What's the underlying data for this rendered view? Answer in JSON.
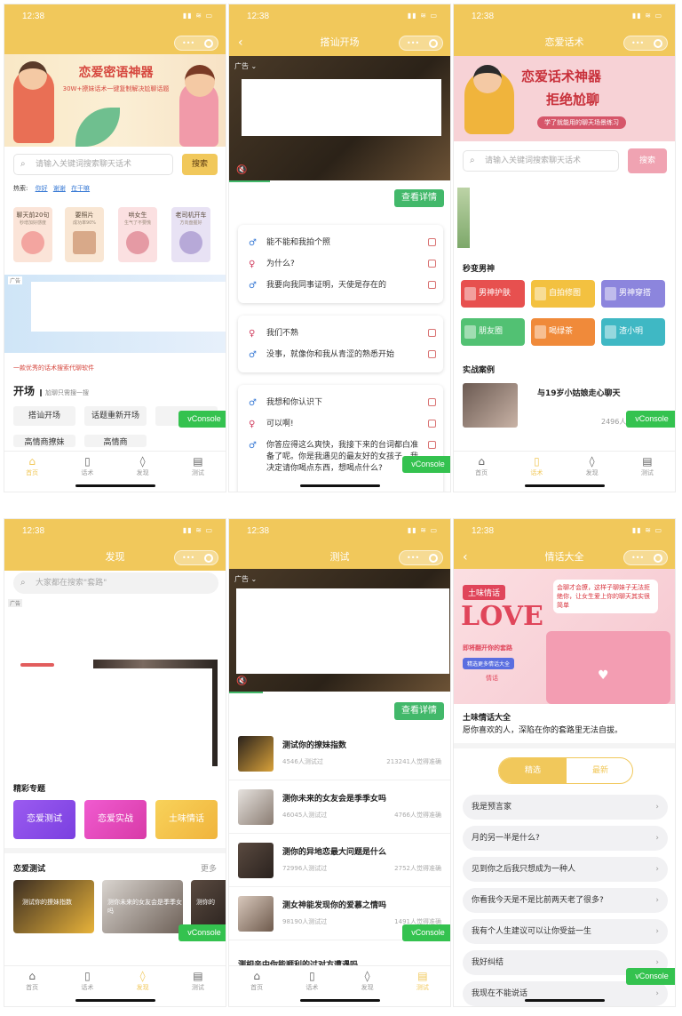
{
  "status": {
    "time": "12:38"
  },
  "capsule": {
    "dots": "•••"
  },
  "console_label": "vConsole",
  "tabs": [
    {
      "label": "首页",
      "icon": "home-icon"
    },
    {
      "label": "话术",
      "icon": "document-icon"
    },
    {
      "label": "发现",
      "icon": "flame-icon"
    },
    {
      "label": "测试",
      "icon": "file-icon"
    }
  ],
  "p1": {
    "banner": {
      "title": "恋爱密语神器",
      "subtitle": "30W+撩妹话术一键复制解决尬聊话题"
    },
    "search": {
      "placeholder": "请输入关键词搜索聊天话术",
      "button": "搜索"
    },
    "hot": {
      "label": "热索:",
      "items": [
        "你好",
        "谢谢",
        "在干嘛"
      ]
    },
    "features": [
      {
        "title": "聊天前20句",
        "sub": "秒增加好感度"
      },
      {
        "title": "要照片",
        "sub": "成功率90%"
      },
      {
        "title": "哄女生",
        "sub": "生气了不要慌"
      },
      {
        "title": "老司机开车",
        "sub": "方向盘握好"
      }
    ],
    "ad_label": "广告",
    "promo": "一款优秀的话术搜索代聊软件",
    "section": {
      "title": "开场",
      "sub": "尬聊只需搜一搜"
    },
    "tags": [
      "搭讪开场",
      "话题重新开场",
      "高情商撩妹",
      "高情商"
    ]
  },
  "p2": {
    "nav_title": "搭讪开场",
    "ad_label": "广告",
    "detail_button": "查看详情",
    "cards": [
      [
        {
          "sex": "m",
          "text": "能不能和我拍个照"
        },
        {
          "sex": "f",
          "text": "为什么?"
        },
        {
          "sex": "m",
          "text": "我要向我同事证明，天使是存在的"
        }
      ],
      [
        {
          "sex": "f",
          "text": "我们不熟"
        },
        {
          "sex": "m",
          "text": "没事，就像你和我从青涩的熟悉开始"
        }
      ],
      [
        {
          "sex": "m",
          "text": "我想和你认识下"
        },
        {
          "sex": "f",
          "text": "可以啊!"
        },
        {
          "sex": "m",
          "text": "你答应得这么爽快，我接下来的台词都白准备了呢。你是我遇见的最友好的女孩子，我决定请你喝点东西，想喝点什么?"
        }
      ]
    ]
  },
  "p3": {
    "nav_title": "恋爱话术",
    "banner": {
      "line1": "恋爱话术神器",
      "line2": "拒绝尬聊",
      "tagline": "学了就能用的聊天场景练习"
    },
    "search": {
      "placeholder": "请输入关键词搜索聊天话术",
      "button": "搜索"
    },
    "section1": "秒变男神",
    "categories": [
      "男神护肤",
      "自拍修图",
      "男神穿搭",
      "朋友圈",
      "喝绿茶",
      "渣小明"
    ],
    "section2": "实战案例",
    "case": {
      "title": "与19岁小姑娘走心聊天",
      "count": "2496人"
    }
  },
  "p4": {
    "nav_title": "发现",
    "search_placeholder": "大家都在搜索\"套路\"",
    "ad_label": "广告",
    "section1": "精彩专题",
    "topics": [
      "恋爱测试",
      "恋爱实战",
      "土味情话"
    ],
    "section2": "恋爱测试",
    "more": "更多",
    "test_cards": [
      "测试你的撩妹指数",
      "测你未来的女友会是季季女吗",
      "测你的"
    ]
  },
  "p5": {
    "nav_title": "测试",
    "ad_label": "广告",
    "detail_button": "查看详情",
    "tests": [
      {
        "title": "测试你的撩妹指数",
        "count": "4546人测试过",
        "acc": "213241人觉得准确"
      },
      {
        "title": "测你未来的女友会是季季女吗",
        "count": "46045人测试过",
        "acc": "4766人觉得准确"
      },
      {
        "title": "测你的异地恋最大问题是什么",
        "count": "72996人测试过",
        "acc": "2752人觉得准确"
      },
      {
        "title": "测女神能发现你的爱慕之情吗",
        "count": "98190人测试过",
        "acc": "1491人觉得准确"
      },
      {
        "title": "测相亲中你能顺利的过对方遭遇吗",
        "count": "",
        "acc": ""
      }
    ]
  },
  "p6": {
    "nav_title": "情话大全",
    "banner": {
      "tag": "土味情话",
      "big": "LOVE",
      "chat": "会聊才会撩，这样子聊妹子无法拒绝你，让女生爱上你的聊天其实很简单",
      "hint": "即将翻开你的套路",
      "btn": "精选更多情话大全",
      "tag2": "情话"
    },
    "title": "土味情话大全",
    "sub": "愿你喜欢的人，深陷在你的套路里无法自拔。",
    "seg": [
      "精选",
      "最新"
    ],
    "items": [
      "我是预言家",
      "月的另一半是什么?",
      "见到你之后我只想成为一种人",
      "你看我今天是不是比前两天老了很多?",
      "我有个人生建议可以让你受益一生",
      "我好纠结",
      "我现在不能说话"
    ]
  }
}
